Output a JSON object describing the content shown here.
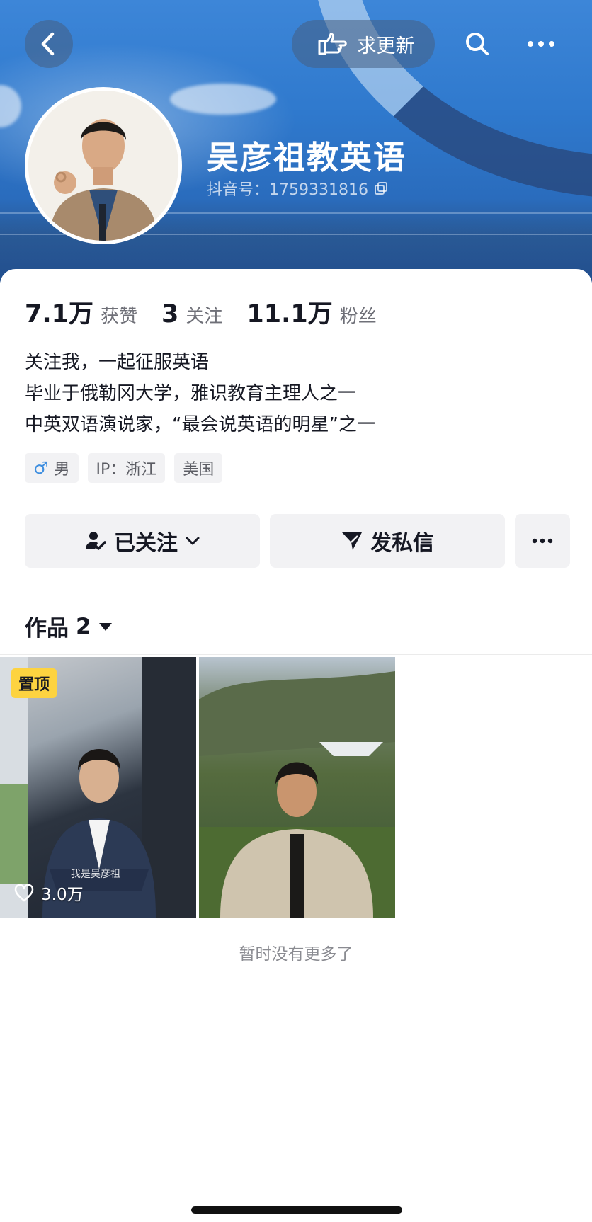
{
  "topbar": {
    "update_label": "求更新"
  },
  "profile": {
    "name": "吴彦祖教英语",
    "douyin_id": "抖音号：1759331816"
  },
  "stats": [
    {
      "value": "7.1万",
      "label": "获赞"
    },
    {
      "value": "3",
      "label": "关注"
    },
    {
      "value": "11.1万",
      "label": "粉丝"
    }
  ],
  "bio": {
    "line1": "关注我，一起征服英语",
    "line2": "毕业于俄勒冈大学，雅识教育主理人之一",
    "line3": "中英双语演说家，“最会说英语的明星”之一"
  },
  "tags": {
    "gender": "男",
    "ip": "IP：浙江",
    "country": "美国"
  },
  "actions": {
    "follow_label": "已关注",
    "message_label": "发私信"
  },
  "works": {
    "label": "作品",
    "count": "2",
    "items": [
      {
        "badge": "置顶",
        "likes": "3.0万",
        "caption": "我是吴彦祖"
      },
      {
        "badge": "",
        "likes": "",
        "caption": ""
      }
    ]
  },
  "footer": {
    "no_more_text": "暂时没有更多了"
  },
  "colors": {
    "header_blue": "#2f79cd",
    "pin_badge": "#fdd340",
    "male_icon": "#3f8fe0"
  }
}
